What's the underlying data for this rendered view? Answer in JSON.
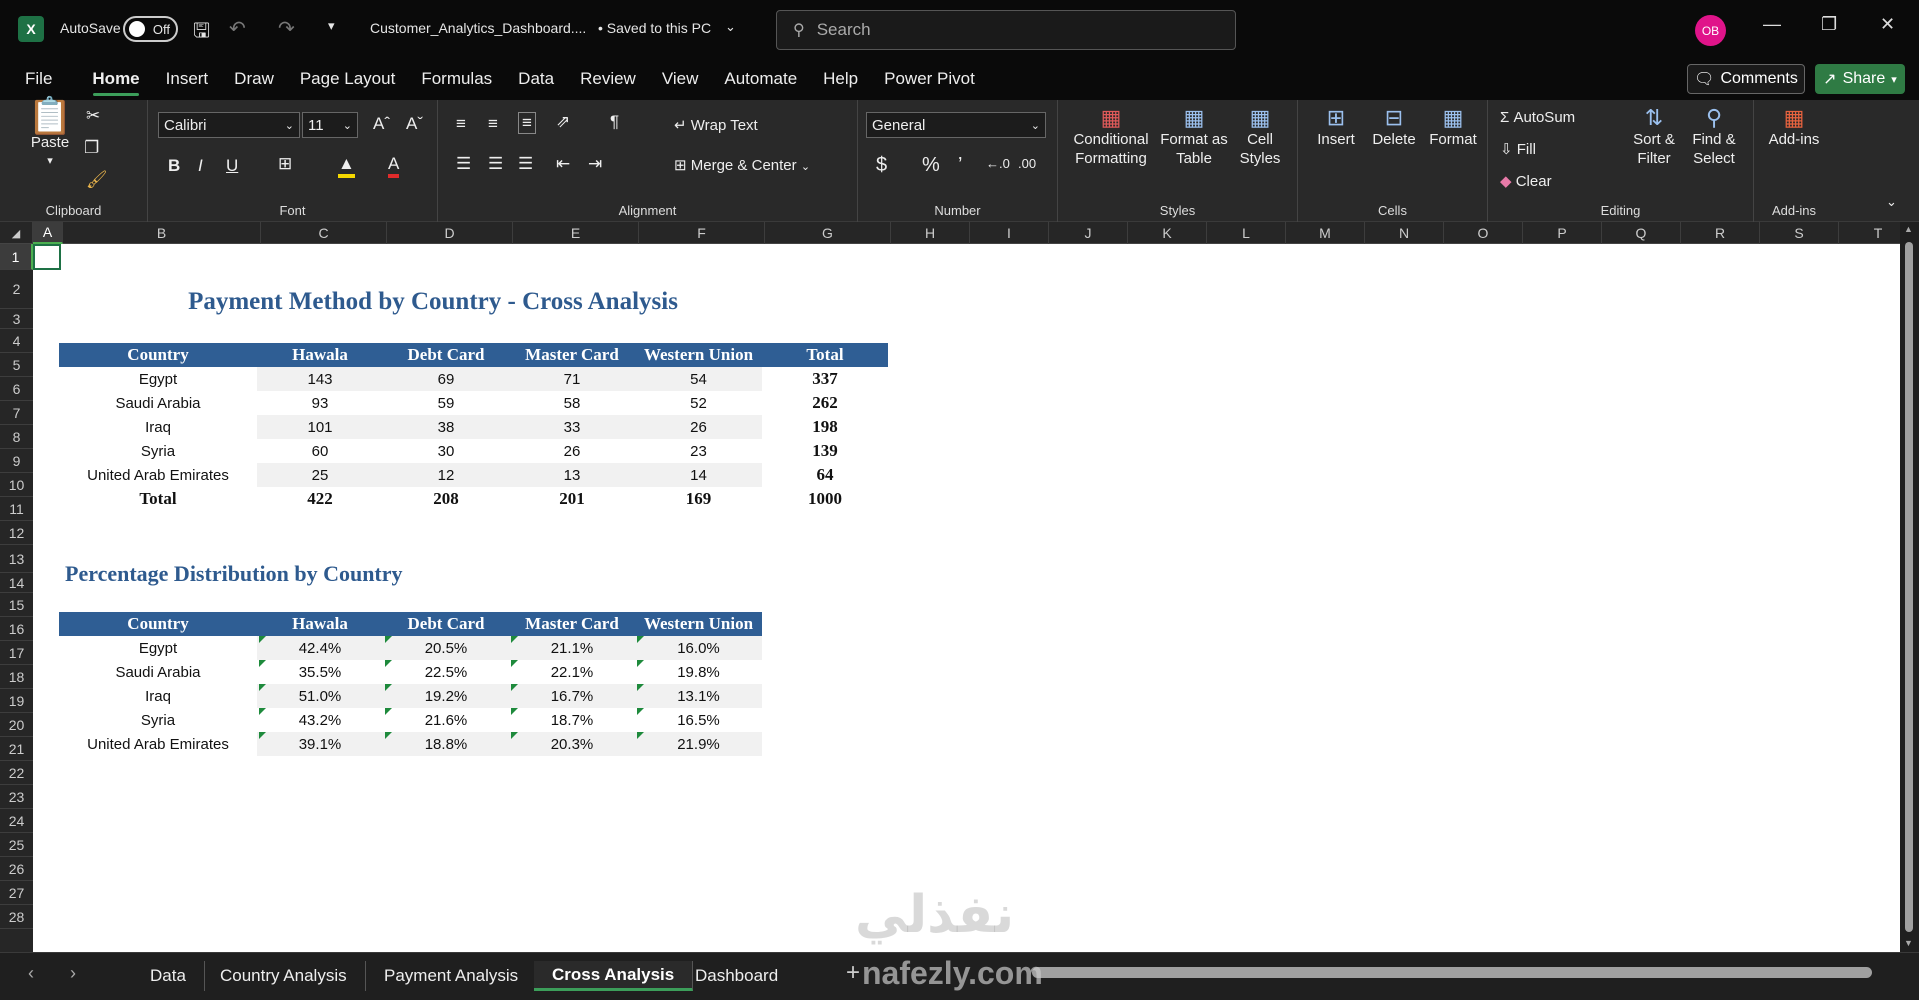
{
  "titlebar": {
    "autosave_label": "AutoSave",
    "autosave_state": "Off",
    "filename": "Customer_Analytics_Dashboard....",
    "save_status": "• Saved to this PC",
    "search_placeholder": "Search",
    "avatar_initials": "OB"
  },
  "menu": {
    "items": [
      "File",
      "Home",
      "Insert",
      "Draw",
      "Page Layout",
      "Formulas",
      "Data",
      "Review",
      "View",
      "Automate",
      "Help",
      "Power Pivot"
    ],
    "active": "Home",
    "comments_label": "Comments",
    "share_label": "Share"
  },
  "ribbon": {
    "clipboard": {
      "paste": "Paste",
      "label": "Clipboard"
    },
    "font": {
      "name": "Calibri",
      "size": "11",
      "label": "Font"
    },
    "alignment": {
      "wrap_text": "Wrap Text",
      "merge_center": "Merge & Center",
      "label": "Alignment"
    },
    "number": {
      "format": "General",
      "label": "Number"
    },
    "styles": {
      "conditional": "Conditional Formatting",
      "format_table": "Format as Table",
      "cell_styles": "Cell Styles",
      "label": "Styles"
    },
    "cells": {
      "insert": "Insert",
      "delete": "Delete",
      "format": "Format",
      "label": "Cells"
    },
    "editing": {
      "autosum": "AutoSum",
      "fill": "Fill",
      "clear": "Clear",
      "sort_filter": "Sort & Filter",
      "find_select": "Find & Select",
      "label": "Editing"
    },
    "addins": {
      "addins": "Add-ins",
      "label": "Add-ins"
    }
  },
  "grid": {
    "columns": [
      "A",
      "B",
      "C",
      "D",
      "E",
      "F",
      "G",
      "H",
      "I",
      "J",
      "K",
      "L",
      "M",
      "N",
      "O",
      "P",
      "Q",
      "R",
      "S",
      "T"
    ],
    "rows": [
      "1",
      "2",
      "3",
      "4",
      "5",
      "6",
      "7",
      "8",
      "9",
      "10",
      "11",
      "12",
      "13",
      "14",
      "15",
      "16",
      "17",
      "18",
      "19",
      "20",
      "21",
      "22",
      "23",
      "24",
      "25",
      "26",
      "27",
      "28"
    ]
  },
  "sheet": {
    "title1": "Payment Method by Country - Cross Analysis",
    "table1": {
      "headers": [
        "Country",
        "Hawala",
        "Debt Card",
        "Master Card",
        "Western Union",
        "Total"
      ],
      "rows": [
        [
          "Egypt",
          "143",
          "69",
          "71",
          "54",
          "337"
        ],
        [
          "Saudi Arabia",
          "93",
          "59",
          "58",
          "52",
          "262"
        ],
        [
          "Iraq",
          "101",
          "38",
          "33",
          "26",
          "198"
        ],
        [
          "Syria",
          "60",
          "30",
          "26",
          "23",
          "139"
        ],
        [
          "United Arab Emirates",
          "25",
          "12",
          "13",
          "14",
          "64"
        ]
      ],
      "total_row": [
        "Total",
        "422",
        "208",
        "201",
        "169",
        "1000"
      ]
    },
    "title2": "Percentage Distribution by Country",
    "table2": {
      "headers": [
        "Country",
        "Hawala",
        "Debt Card",
        "Master Card",
        "Western Union"
      ],
      "rows": [
        [
          "Egypt",
          "42.4%",
          "20.5%",
          "21.1%",
          "16.0%"
        ],
        [
          "Saudi Arabia",
          "35.5%",
          "22.5%",
          "22.1%",
          "19.8%"
        ],
        [
          "Iraq",
          "51.0%",
          "19.2%",
          "16.7%",
          "13.1%"
        ],
        [
          "Syria",
          "43.2%",
          "21.6%",
          "18.7%",
          "16.5%"
        ],
        [
          "United Arab Emirates",
          "39.1%",
          "18.8%",
          "20.3%",
          "21.9%"
        ]
      ]
    }
  },
  "tabs": [
    "Data",
    "Country Analysis",
    "Payment Analysis",
    "Cross Analysis",
    "Dashboard"
  ],
  "active_tab": "Cross Analysis",
  "watermark": {
    "arabic": "نفذلي",
    "latin": "nafezly.com"
  },
  "colors": {
    "header_fill": "#2f5e94",
    "title_text": "#2e5a8e",
    "accent_green": "#3c9e5a"
  }
}
